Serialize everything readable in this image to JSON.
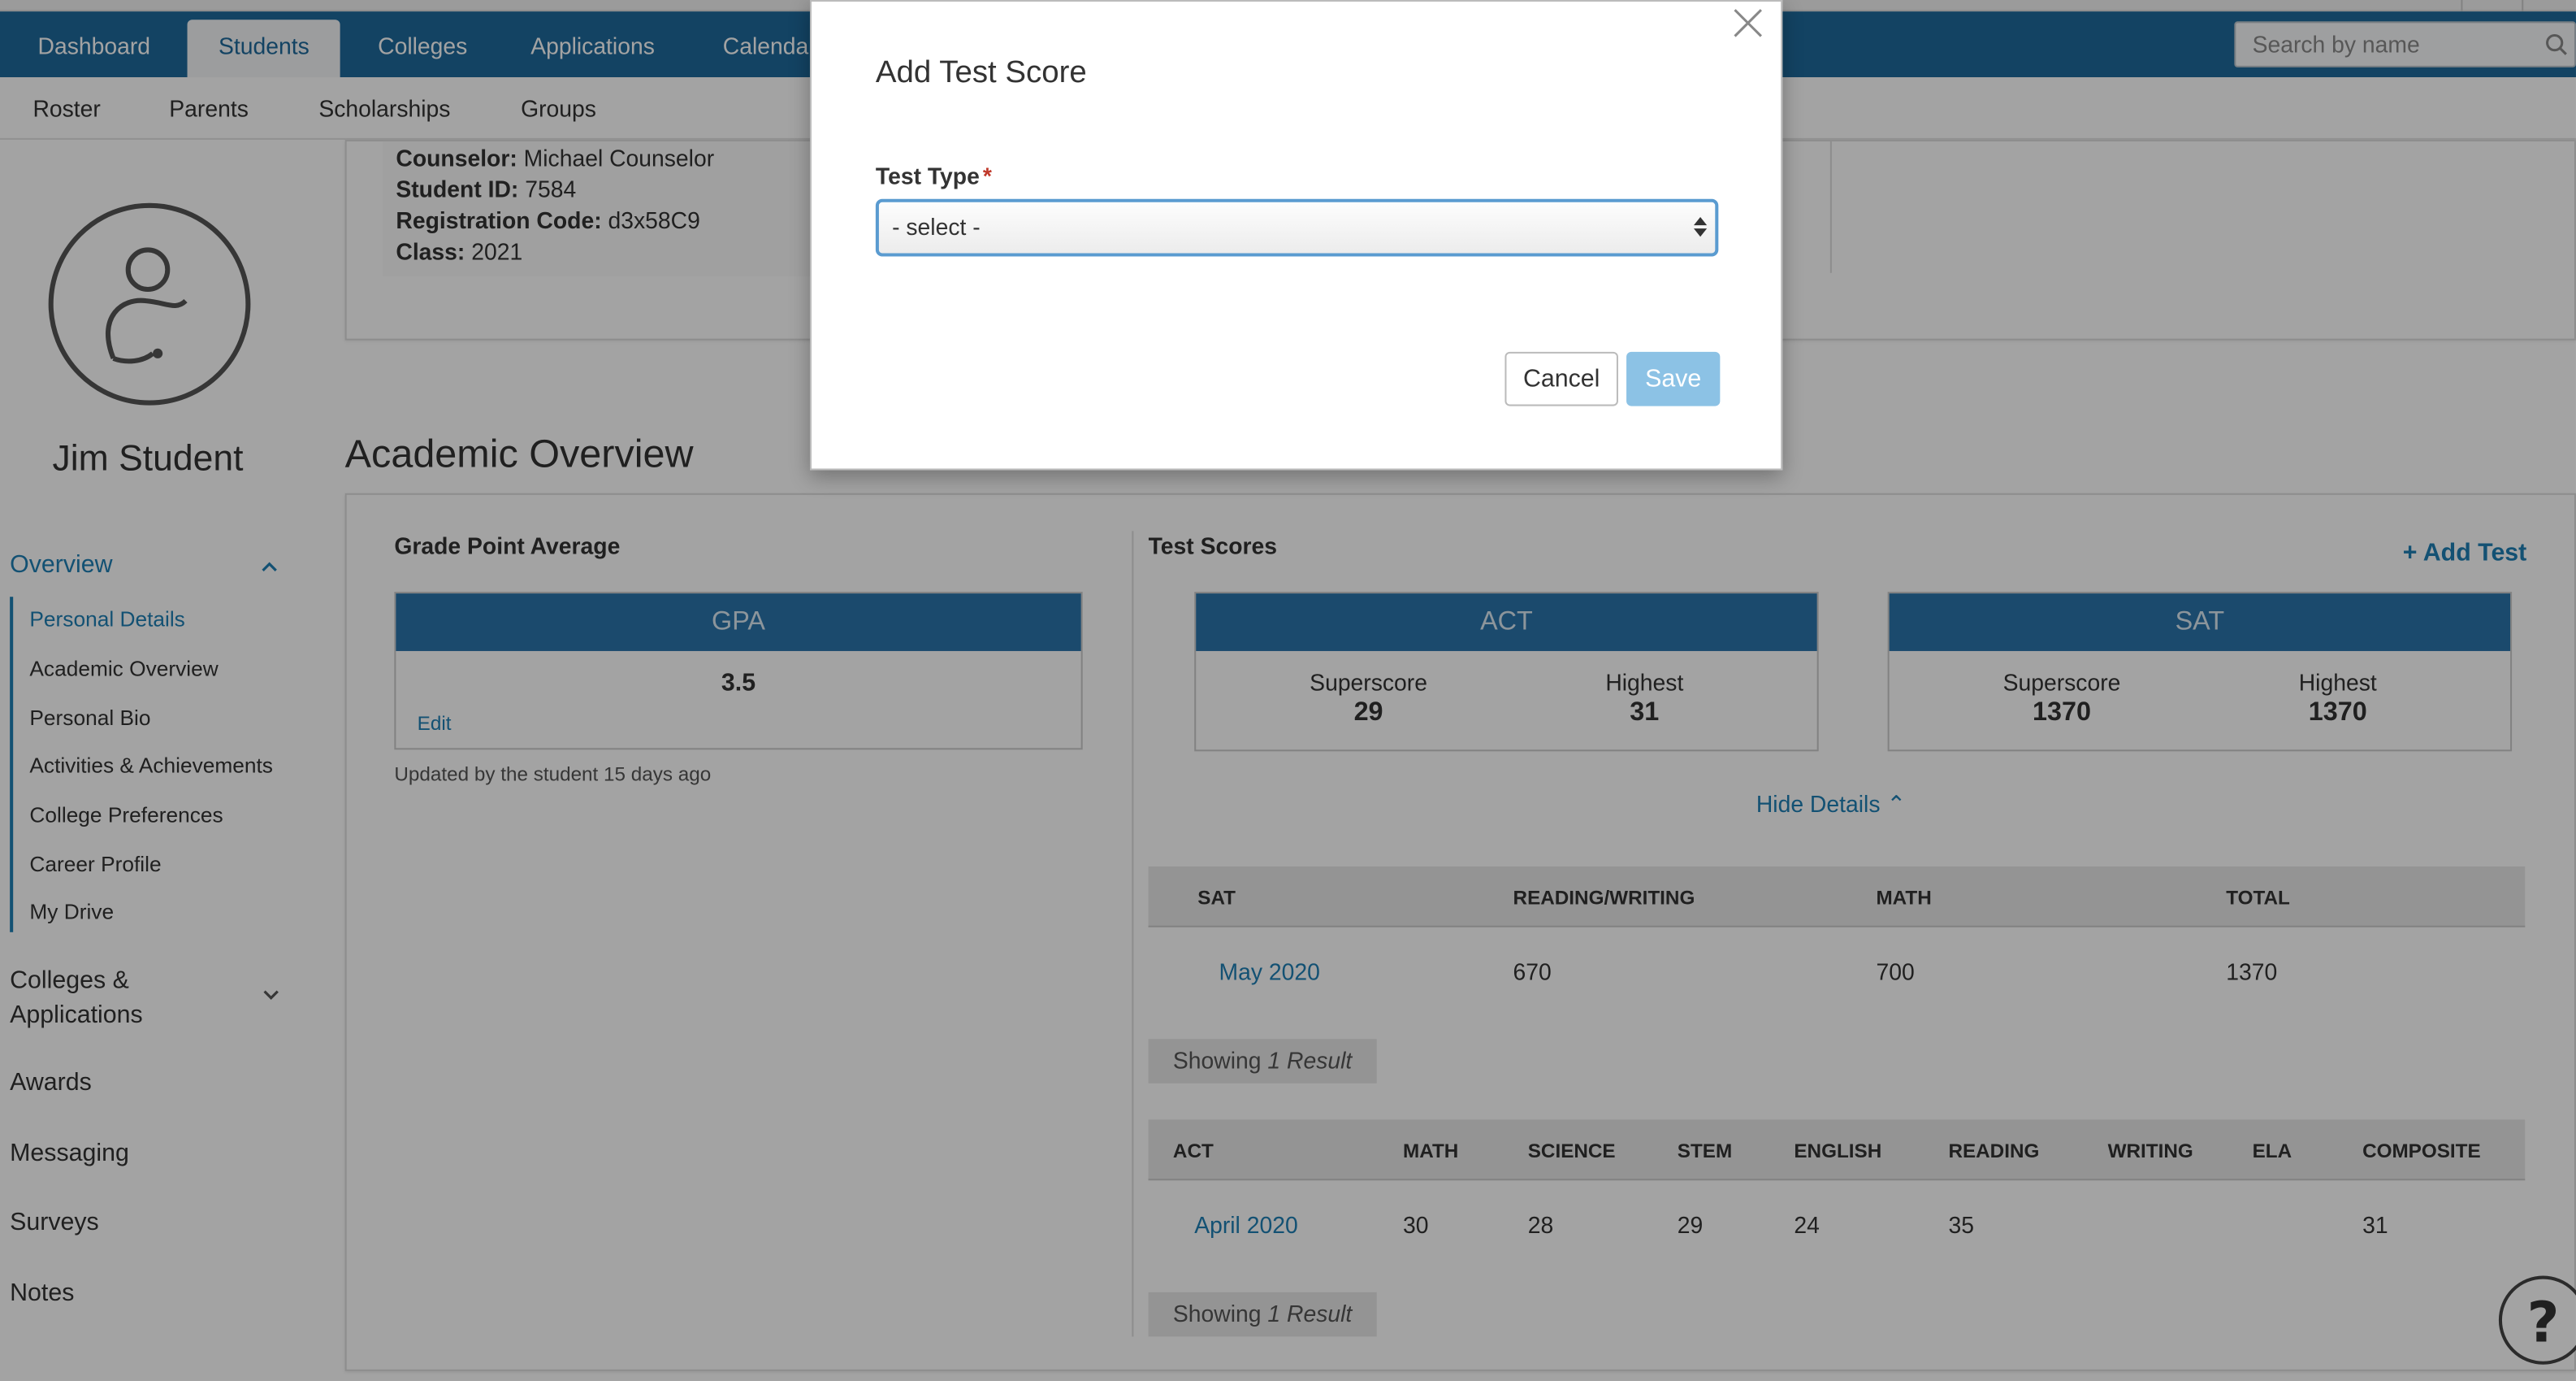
{
  "nav": {
    "tabs": [
      {
        "label": "Dashboard"
      },
      {
        "label": "Students"
      },
      {
        "label": "Colleges"
      },
      {
        "label": "Applications"
      },
      {
        "label": "Calendar"
      }
    ],
    "search_placeholder": "Search by name"
  },
  "subnav": {
    "items": [
      {
        "label": "Roster"
      },
      {
        "label": "Parents"
      },
      {
        "label": "Scholarships"
      },
      {
        "label": "Groups"
      }
    ]
  },
  "student": {
    "name": "Jim Student",
    "counselor_label": "Counselor:",
    "counselor": "Michael Counselor",
    "id_label": "Student ID:",
    "id": "7584",
    "reg_label": "Registration Code:",
    "reg_code": "d3x58C9",
    "class_label": "Class:",
    "class": "2021"
  },
  "sidebar": {
    "overview": "Overview",
    "items": [
      {
        "label": "Personal Details"
      },
      {
        "label": "Academic Overview"
      },
      {
        "label": "Personal Bio"
      },
      {
        "label": "Activities & Achievements"
      },
      {
        "label": "College Preferences"
      },
      {
        "label": "Career Profile"
      },
      {
        "label": "My Drive"
      }
    ],
    "colleges_line1": "Colleges &",
    "colleges_line2": "Applications",
    "awards": "Awards",
    "messaging": "Messaging",
    "surveys": "Surveys",
    "notes": "Notes"
  },
  "academic": {
    "title": "Academic Overview",
    "gpa_heading": "Grade Point Average",
    "gpa_box_title": "GPA",
    "gpa_value": "3.5",
    "gpa_edit": "Edit",
    "updated": "Updated by the student 15 days ago",
    "tests_heading": "Test Scores",
    "add_test": "Add Test",
    "act": {
      "title": "ACT",
      "superscore_label": "Superscore",
      "superscore": "29",
      "highest_label": "Highest",
      "highest": "31"
    },
    "sat": {
      "title": "SAT",
      "superscore_label": "Superscore",
      "superscore": "1370",
      "highest_label": "Highest",
      "highest": "1370"
    },
    "hide_details": "Hide Details",
    "sat_table": {
      "headers": [
        "SAT",
        "READING/WRITING",
        "MATH",
        "TOTAL"
      ],
      "row": [
        "May 2020",
        "670",
        "700",
        "1370"
      ]
    },
    "act_table": {
      "headers": [
        "ACT",
        "MATH",
        "SCIENCE",
        "STEM",
        "ENGLISH",
        "READING",
        "WRITING",
        "ELA",
        "COMPOSITE"
      ],
      "row": [
        "April 2020",
        "30",
        "28",
        "29",
        "24",
        "35",
        "",
        "",
        "31"
      ]
    },
    "showing_prefix": "Showing",
    "showing_count": "1 Result"
  },
  "modal": {
    "title": "Add Test Score",
    "field_label": "Test Type",
    "required_mark": "*",
    "select_value": "- select -",
    "cancel": "Cancel",
    "save": "Save"
  },
  "colors": {
    "nav": "#1f6a9b",
    "link": "#1f7fb5",
    "box_header": "#2b74ab",
    "save_disabled": "#8cc2e5"
  }
}
